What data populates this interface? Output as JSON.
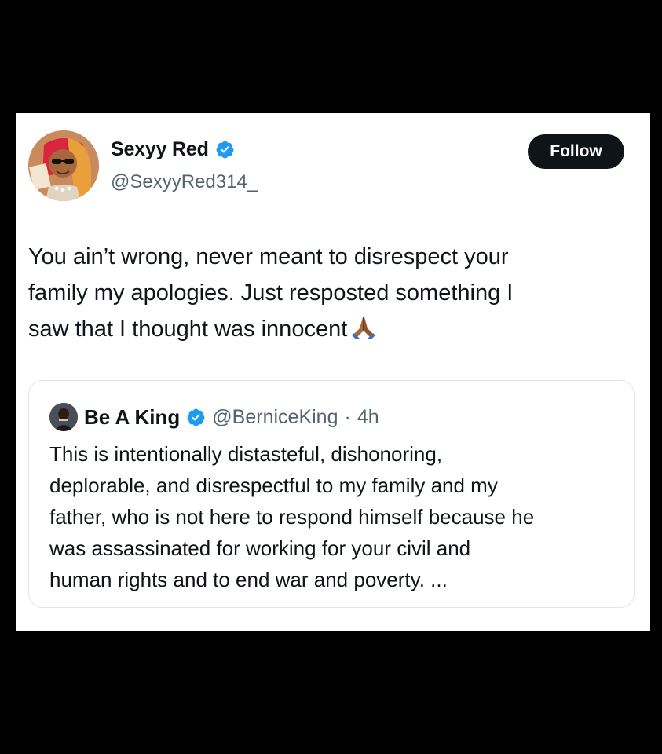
{
  "tweet": {
    "author": {
      "name": "Sexyy Red",
      "handle": "@SexyyRed314_",
      "verified": true
    },
    "follow_label": "Follow",
    "text": "You ain’t wrong, never meant to disrespect your\nfamily my apologies. Just resposted something I\nsaw that I thought was innocent",
    "emoji": "folded-hands-icon"
  },
  "quoted_tweet": {
    "author": {
      "name": "Be A King",
      "handle": "@BerniceKing",
      "verified": true
    },
    "separator": "·",
    "time": "4h",
    "text": "This is intentionally distasteful, dishonoring,\ndeplorable, and disrespectful to my family and my\nfather, who is not here to respond himself because he\nwas assassinated for working for your civil and\nhuman rights and to end war and poverty.  ..."
  },
  "colors": {
    "background": "#000000",
    "card": "#ffffff",
    "text": "#0f1419",
    "secondary_text": "#536471",
    "verified_badge": "#1d9bf0",
    "follow_button": "#0f1419"
  }
}
